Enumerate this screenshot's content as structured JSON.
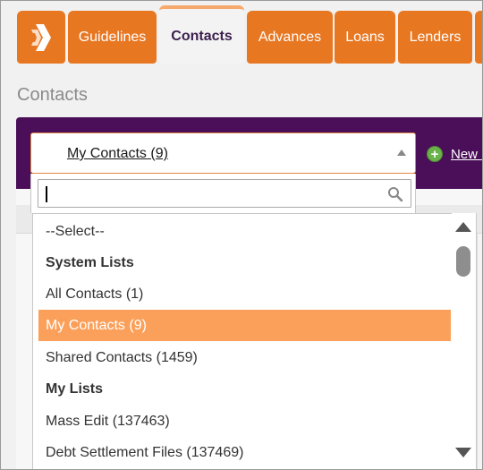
{
  "tabs": [
    {
      "label": "Guidelines"
    },
    {
      "label": "Contacts"
    },
    {
      "label": "Advances"
    },
    {
      "label": "Loans"
    },
    {
      "label": "Lenders"
    }
  ],
  "page": {
    "title": "Contacts"
  },
  "list_select": {
    "value": "My Contacts (9)",
    "new_link": "New l"
  },
  "search": {
    "value": "",
    "icon": "search-icon"
  },
  "options": [
    {
      "label": "--Select--",
      "type": "option"
    },
    {
      "label": "System Lists",
      "type": "group"
    },
    {
      "label": "All Contacts (1)",
      "type": "option"
    },
    {
      "label": "My Contacts (9)",
      "type": "option",
      "selected": true
    },
    {
      "label": "Shared Contacts (1459)",
      "type": "option"
    },
    {
      "label": "My Lists",
      "type": "group"
    },
    {
      "label": "Mass Edit (137463)",
      "type": "option"
    },
    {
      "label": "Debt Settlement Files (137469)",
      "type": "option"
    }
  ],
  "colors": {
    "accent": "#e87722",
    "selected_option": "#fba05a",
    "toolbar": "#4a0f58",
    "active_tab_text": "#3b1e4c"
  }
}
